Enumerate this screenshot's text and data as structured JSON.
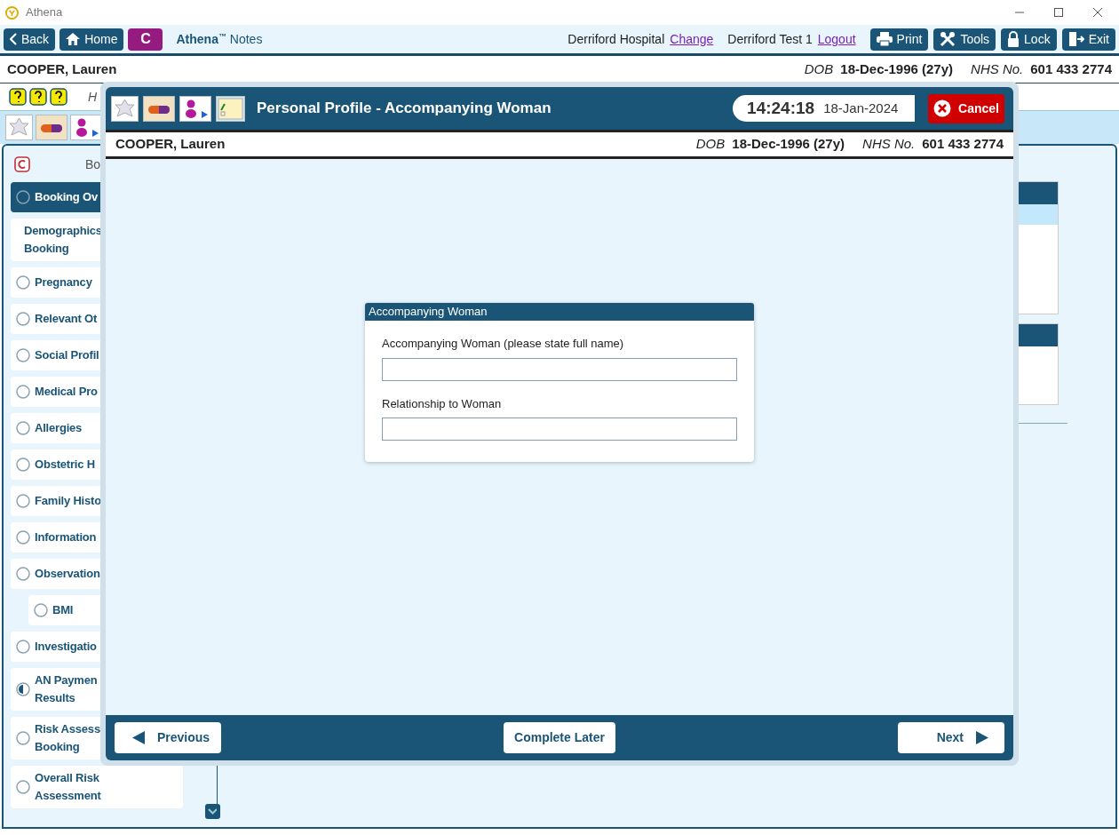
{
  "app": {
    "title": "Athena"
  },
  "toolbar": {
    "back": "Back",
    "home": "Home",
    "c_button": "C",
    "brand": "Athena",
    "brand_mark": "™",
    "brand_suffix": "Notes",
    "hospital": "Derriford Hospital",
    "change_link": "Change",
    "user": "Derriford Test 1",
    "logout_link": "Logout",
    "buttons": [
      {
        "kind": "print",
        "label": "Print"
      },
      {
        "kind": "tools",
        "label": "Tools"
      },
      {
        "kind": "lock",
        "label": "Lock"
      },
      {
        "kind": "exit",
        "label": "Exit"
      }
    ]
  },
  "patient": {
    "name": "COOPER, Lauren",
    "dob_label": "DOB",
    "dob": "18-Dec-1996 (27y)",
    "nhs_label": "NHS No.",
    "nhs": "601 433 2774"
  },
  "subheader": {
    "text": "H"
  },
  "sidebar": {
    "title": "Bo",
    "items": [
      {
        "label": "Booking Ov",
        "kind": "empty",
        "selected": true
      },
      {
        "label": "Demographics\nBooking",
        "kind": "plain",
        "selected": false
      },
      {
        "label": "Pregnancy",
        "kind": "empty",
        "selected": false
      },
      {
        "label": "Relevant Ot",
        "kind": "empty",
        "selected": false
      },
      {
        "label": "Social Profil",
        "kind": "empty",
        "selected": false
      },
      {
        "label": "Medical Pro",
        "kind": "empty",
        "selected": false
      },
      {
        "label": "Allergies",
        "kind": "empty",
        "selected": false
      },
      {
        "label": "Obstetric H",
        "kind": "empty",
        "selected": false
      },
      {
        "label": "Family Histo",
        "kind": "empty",
        "selected": false
      },
      {
        "label": "Information",
        "kind": "empty",
        "selected": false
      },
      {
        "label": "Observation",
        "kind": "empty",
        "selected": false,
        "children": [
          {
            "label": "BMI",
            "kind": "empty",
            "selected": false
          }
        ]
      },
      {
        "label": "Investigatio",
        "kind": "empty",
        "selected": false
      },
      {
        "label": "AN Paymen\nResults",
        "kind": "partial",
        "selected": false
      },
      {
        "label": "Risk Assess\nBooking",
        "kind": "empty",
        "selected": false
      },
      {
        "label": "Overall Risk\nAssessment",
        "kind": "empty",
        "selected": false
      }
    ]
  },
  "modal": {
    "title": "Personal Profile - Accompanying Woman",
    "time": "14:24:18",
    "date": "18-Jan-2024",
    "cancel": "Cancel",
    "patient": {
      "name": "COOPER, Lauren",
      "dob_label": "DOB",
      "dob": "18-Dec-1996 (27y)",
      "nhs_label": "NHS No.",
      "nhs": "601 433 2774"
    },
    "section": {
      "title": "Accompanying Woman",
      "fields": [
        {
          "label": "Accompanying Woman (please state full name)"
        },
        {
          "label": "Relationship to Woman"
        }
      ]
    },
    "footer": {
      "previous": "Previous",
      "complete_later": "Complete Later",
      "next": "Next"
    }
  }
}
